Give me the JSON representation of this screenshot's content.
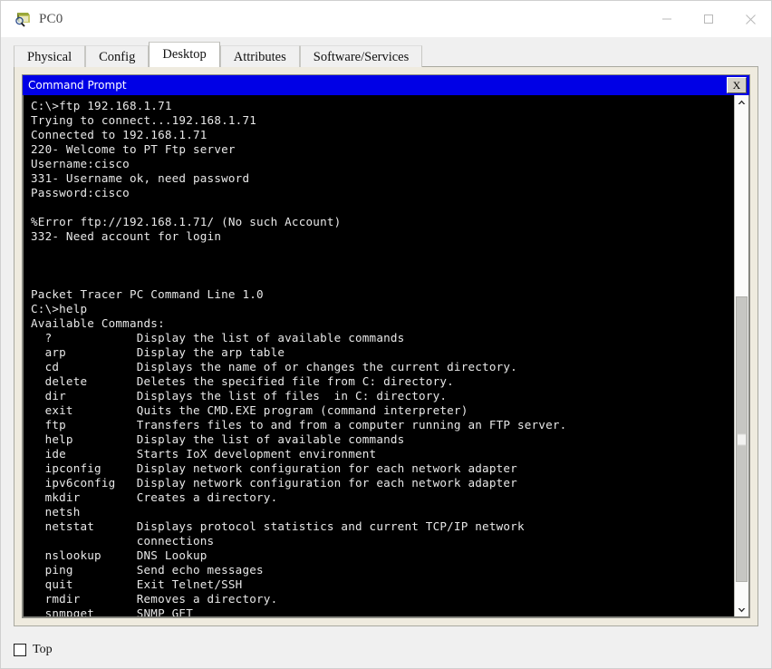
{
  "window": {
    "title": "PC0",
    "icon": "pc-device-icon",
    "controls": {
      "minimize": "minimize-icon",
      "maximize": "maximize-icon",
      "close": "close-icon"
    }
  },
  "tabs": [
    {
      "label": "Physical",
      "active": false
    },
    {
      "label": "Config",
      "active": false
    },
    {
      "label": "Desktop",
      "active": true
    },
    {
      "label": "Attributes",
      "active": false
    },
    {
      "label": "Software/Services",
      "active": false
    }
  ],
  "command_prompt": {
    "title": "Command Prompt",
    "close_label": "X",
    "colors": {
      "titlebar": "#0000e6",
      "terminal_background": "#000000",
      "terminal_text": "#e8e8e8",
      "panel": "#efebdf"
    },
    "terminal_output": "C:\\>ftp 192.168.1.71\nTrying to connect...192.168.1.71\nConnected to 192.168.1.71\n220- Welcome to PT Ftp server\nUsername:cisco\n331- Username ok, need password\nPassword:cisco\n\n%Error ftp://192.168.1.71/ (No such Account)\n332- Need account for login\n\n\n\nPacket Tracer PC Command Line 1.0\nC:\\>help\nAvailable Commands:\n  ?            Display the list of available commands\n  arp          Display the arp table\n  cd           Displays the name of or changes the current directory.\n  delete       Deletes the specified file from C: directory.\n  dir          Displays the list of files  in C: directory.\n  exit         Quits the CMD.EXE program (command interpreter)\n  ftp          Transfers files to and from a computer running an FTP server.\n  help         Display the list of available commands\n  ide          Starts IoX development environment\n  ipconfig     Display network configuration for each network adapter\n  ipv6config   Display network configuration for each network adapter\n  mkdir        Creates a directory.\n  netsh\n  netstat      Displays protocol statistics and current TCP/IP network\n               connections\n  nslookup     DNS Lookup\n  ping         Send echo messages\n  quit         Exit Telnet/SSH\n  rmdir        Removes a directory.\n  snmpget      SNMP GET"
  },
  "scrollbar": {
    "up_arrow": "chevron-up-icon",
    "down_arrow": "chevron-down-icon"
  },
  "footer": {
    "top_checkbox_label": "Top",
    "top_checkbox_checked": false
  }
}
